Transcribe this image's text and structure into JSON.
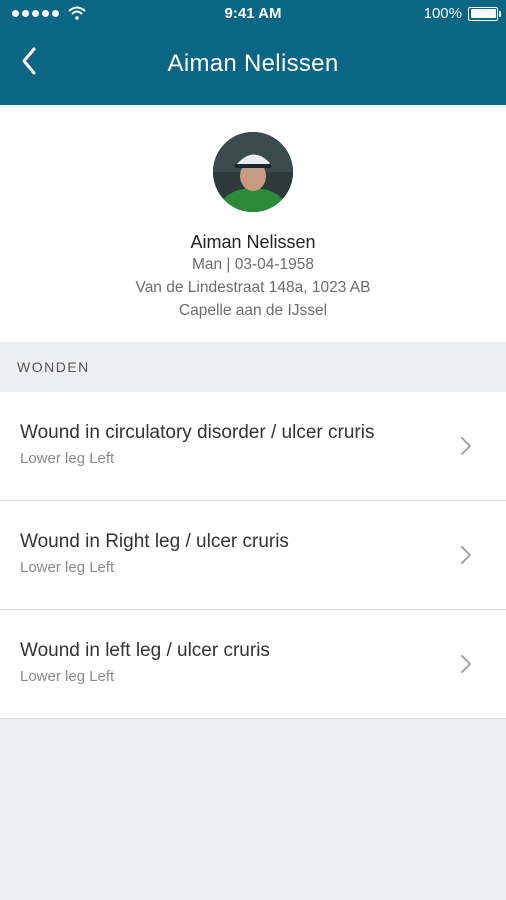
{
  "status_bar": {
    "time": "9:41 AM",
    "battery": "100%",
    "signal_icon": "signal-dots-icon",
    "wifi_icon": "wifi-icon"
  },
  "header": {
    "title": "Aiman Nelissen",
    "back_icon": "chevron-left-icon",
    "background_color": "#0b6683"
  },
  "patient": {
    "name": "Aiman Nelissen",
    "details": "Man | 03-04-1958",
    "address_line1": "Van de Lindestraat 148a, 1023 AB",
    "address_line2": "Capelle aan de IJssel"
  },
  "section": {
    "label": "WONDEN"
  },
  "wounds": [
    {
      "title": "Wound in circulatory disorder / ulcer cruris",
      "location": "Lower leg Left"
    },
    {
      "title": "Wound in Right leg / ulcer cruris",
      "location": "Lower leg Left"
    },
    {
      "title": "Wound in left leg / ulcer cruris",
      "location": "Lower leg Left"
    }
  ]
}
